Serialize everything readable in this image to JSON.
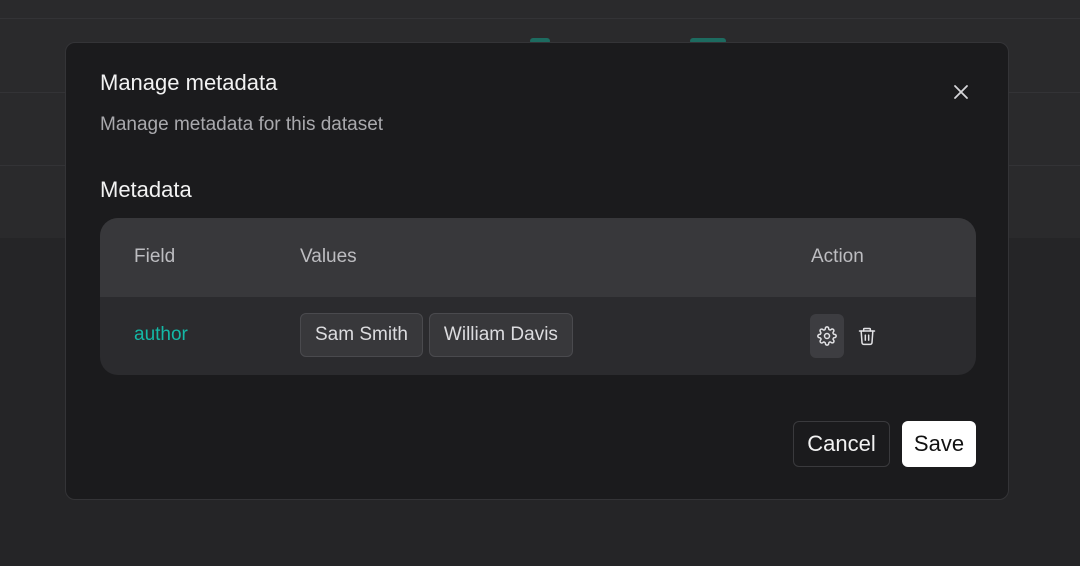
{
  "modal": {
    "title": "Manage metadata",
    "subtitle": "Manage metadata for this dataset",
    "close_icon": "close-icon"
  },
  "section": {
    "title": "Metadata"
  },
  "table": {
    "headers": {
      "field": "Field",
      "values": "Values",
      "action": "Action"
    },
    "rows": [
      {
        "field": "author",
        "values": [
          "Sam Smith",
          "William Davis"
        ],
        "actions": [
          "gear-icon",
          "trash-icon"
        ]
      }
    ]
  },
  "footer": {
    "cancel_label": "Cancel",
    "save_label": "Save"
  },
  "colors": {
    "accent": "#14b8a6",
    "modal_bg": "#1b1b1d",
    "table_header_bg": "#38383b",
    "primary_button_bg": "#ffffff"
  }
}
